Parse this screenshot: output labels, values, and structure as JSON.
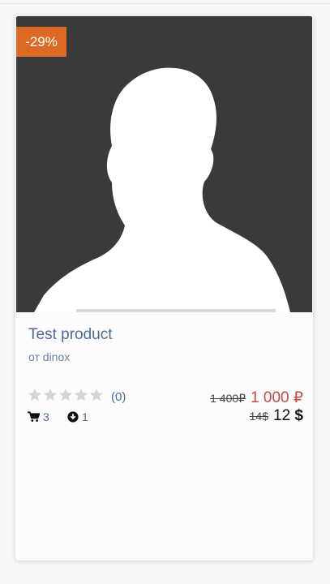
{
  "product": {
    "discount_badge": "-29%",
    "title": "Test product",
    "author": "от dinox",
    "rating": {
      "stars_filled": 0,
      "stars_total": 5,
      "count_text": "(0)"
    },
    "stats": {
      "cart_count": "3",
      "download_count": "1"
    },
    "prices": {
      "old_rub": "1 400₽",
      "new_rub": "1 000 ₽",
      "old_usd": "14$",
      "new_usd_amount": "12",
      "new_usd_symbol": "$"
    },
    "image": {
      "icon": "person-silhouette-placeholder"
    }
  },
  "colors": {
    "badge": "#dc6a24",
    "title": "#4f6b9c",
    "new_price_rub": "#c24a4a",
    "star_empty": "#d2d5da",
    "image_bg": "#3a3a3a"
  }
}
